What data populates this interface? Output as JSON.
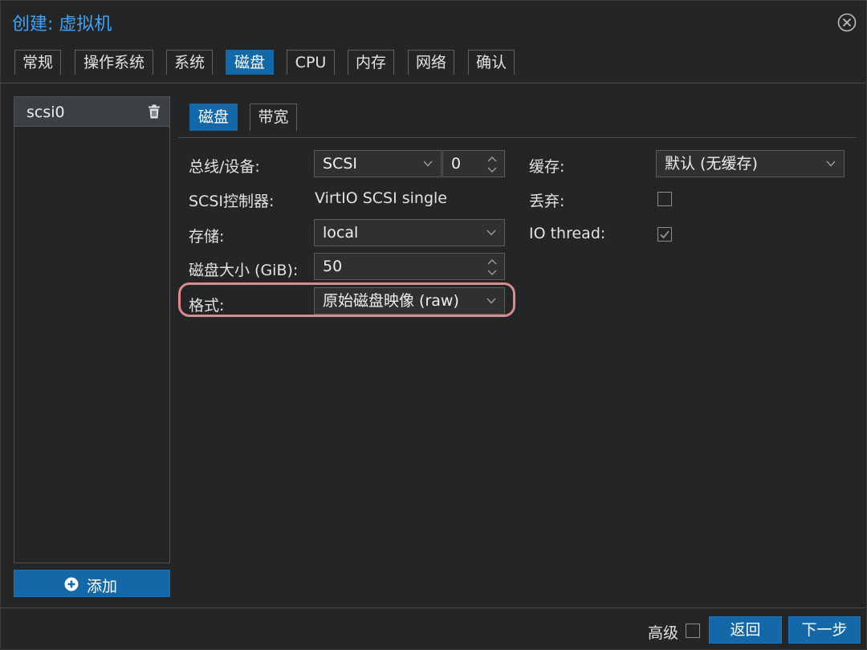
{
  "dialog": {
    "title": "创建: 虚拟机"
  },
  "tabs": [
    "常规",
    "操作系统",
    "系统",
    "磁盘",
    "CPU",
    "内存",
    "网络",
    "确认"
  ],
  "disk_list": {
    "items": [
      "scsi0"
    ],
    "add_label": "添加"
  },
  "subtabs": [
    "磁盘",
    "带宽"
  ],
  "form": {
    "bus_label": "总线/设备:",
    "bus_value": "SCSI",
    "device_value": "0",
    "scsi_ctrl_label": "SCSI控制器:",
    "scsi_ctrl_value": "VirtIO SCSI single",
    "storage_label": "存储:",
    "storage_value": "local",
    "size_label": "磁盘大小 (GiB):",
    "size_value": "50",
    "format_label": "格式:",
    "format_value": "原始磁盘映像 (raw)",
    "cache_label": "缓存:",
    "cache_value": "默认 (无缓存)",
    "discard_label": "丢弃:",
    "discard_checked": false,
    "iothread_label": "IO thread:",
    "iothread_checked": true
  },
  "footer": {
    "advanced_label": "高级",
    "advanced_checked": false,
    "back_label": "返回",
    "next_label": "下一步"
  },
  "colors": {
    "accent": "#1568a8",
    "title": "#41a2f5",
    "highlight": "#d98b8e"
  }
}
